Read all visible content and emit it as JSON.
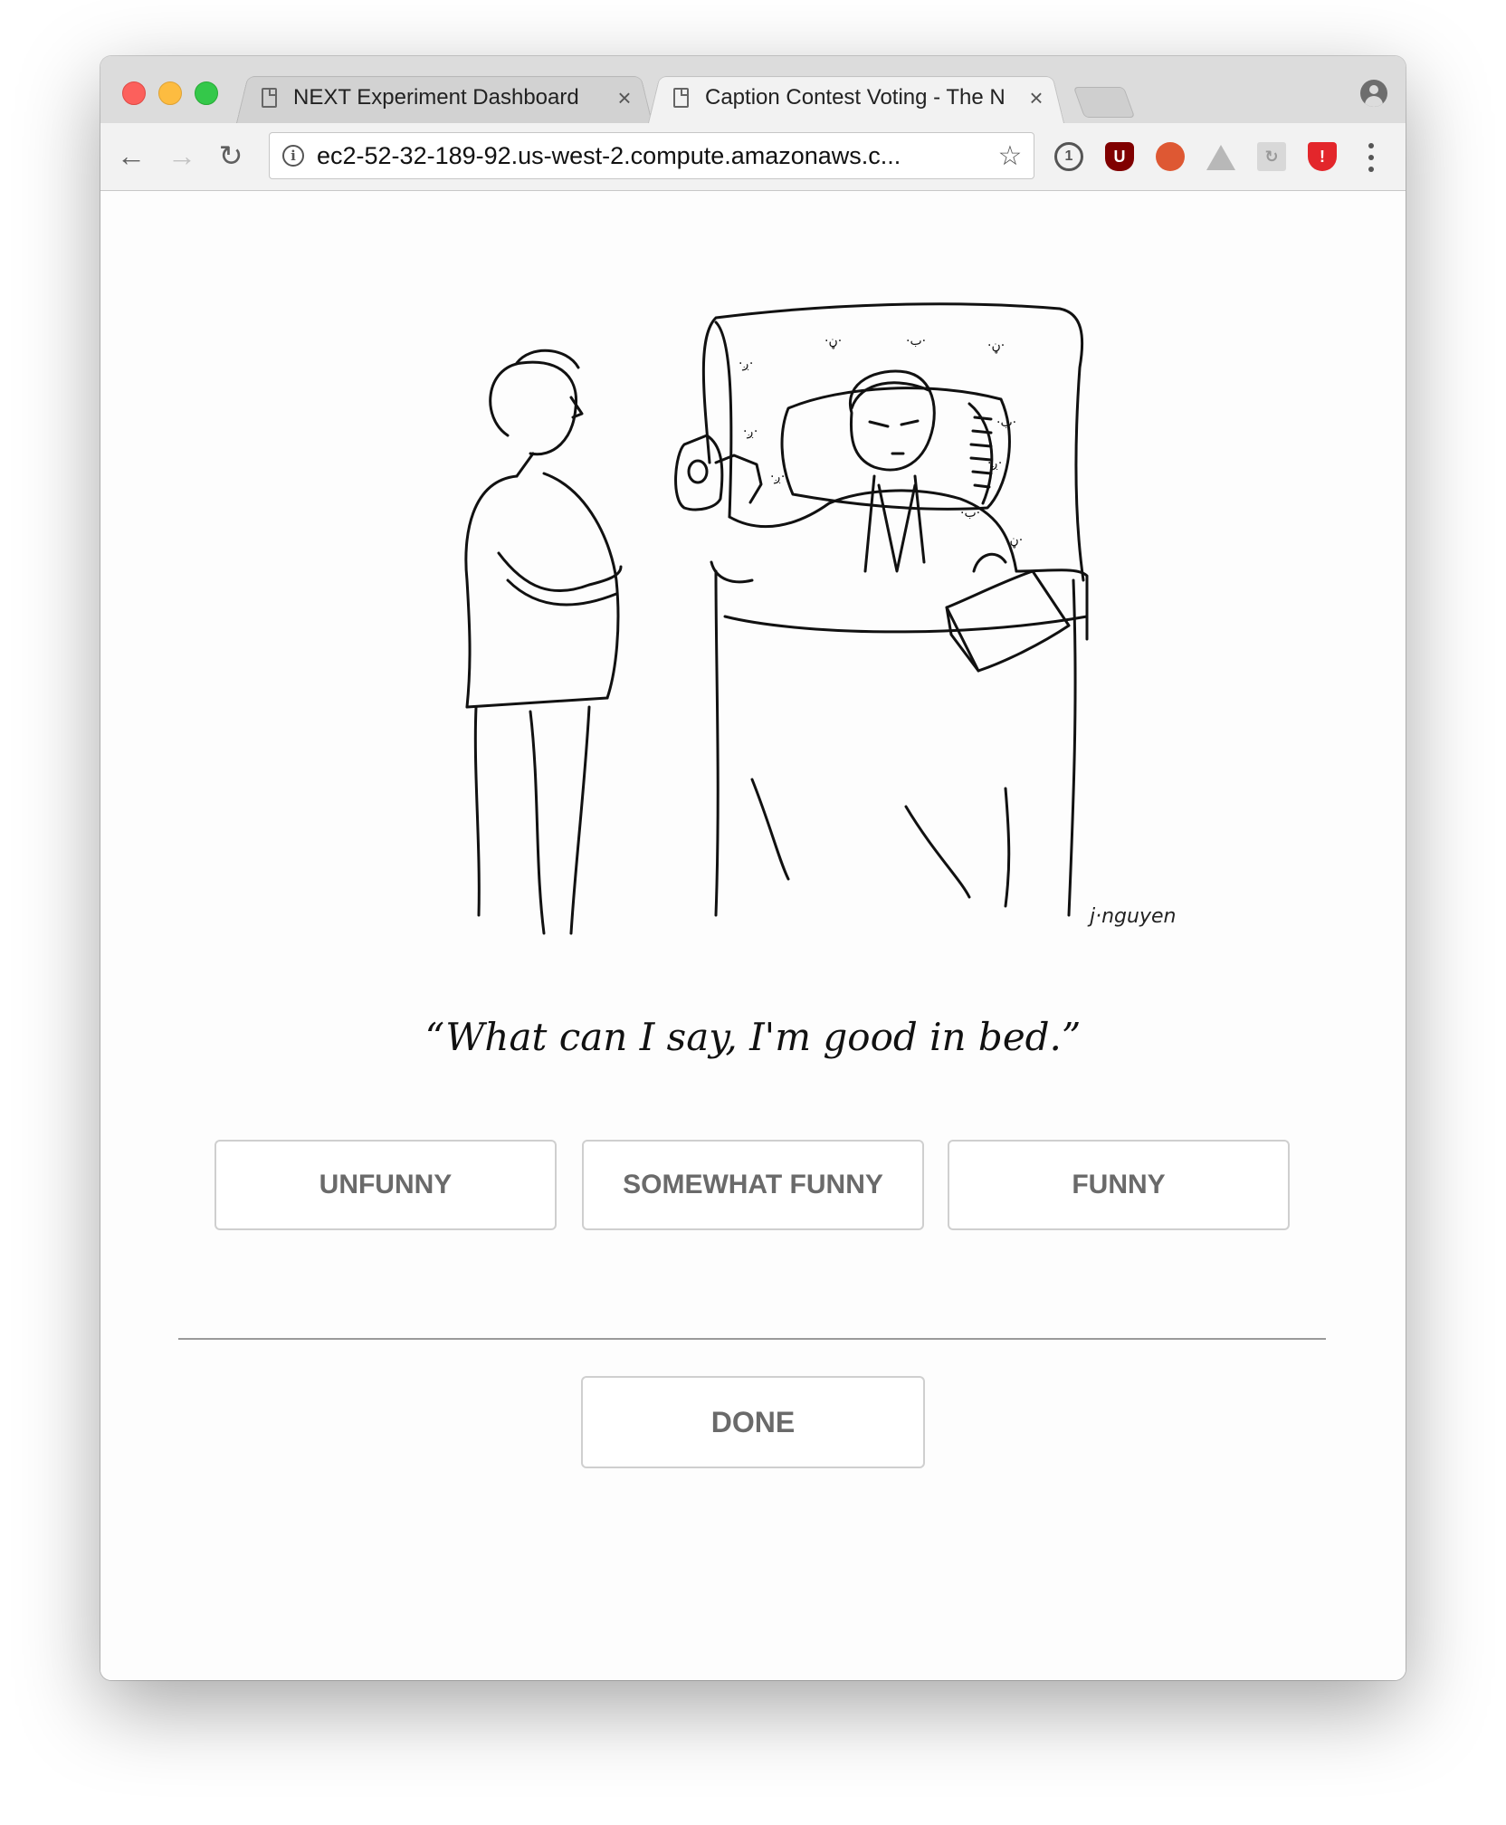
{
  "browser": {
    "tabs": [
      {
        "title": "NEXT Experiment Dashboard",
        "close": "×",
        "active": false
      },
      {
        "title": "Caption Contest Voting - The N",
        "close": "×",
        "active": true
      }
    ],
    "url": "ec2-52-32-189-92.us-west-2.compute.amazonaws.c...",
    "nav": {
      "back": "←",
      "forward": "→",
      "reload": "↻"
    },
    "bookmark_star": "☆",
    "extensions": [
      {
        "name": "onepassword-icon",
        "glyph": "1"
      },
      {
        "name": "ublock-icon",
        "glyph": "U"
      },
      {
        "name": "duckduckgo-icon",
        "glyph": "🦆"
      },
      {
        "name": "google-drive-icon",
        "glyph": ""
      },
      {
        "name": "extension-icon",
        "glyph": "↻"
      },
      {
        "name": "shield-icon",
        "glyph": "!"
      }
    ]
  },
  "cartoon": {
    "signature": "j·nguyen"
  },
  "caption": "“What can I say, I'm good in bed.”",
  "ratings": {
    "unfunny": "UNFUNNY",
    "somewhat": "SOMEWHAT FUNNY",
    "funny": "FUNNY"
  },
  "done_label": "DONE",
  "colors": {
    "button_text": "#6a6a6a",
    "button_border": "#cfcfcf",
    "divider": "#9a9a9a"
  }
}
